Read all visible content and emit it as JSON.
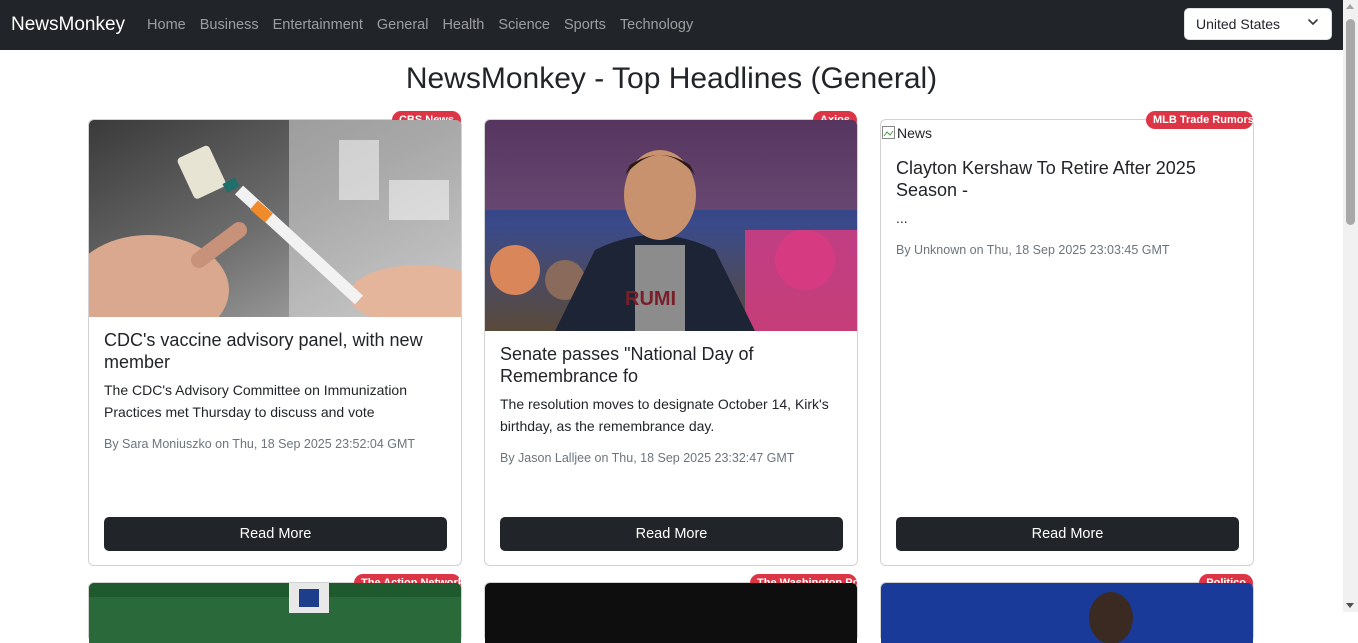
{
  "navbar": {
    "brand": "NewsMonkey",
    "links": [
      "Home",
      "Business",
      "Entertainment",
      "General",
      "Health",
      "Science",
      "Sports",
      "Technology"
    ],
    "country": "United States"
  },
  "page": {
    "title": "NewsMonkey - Top Headlines (General)"
  },
  "articles": [
    {
      "source": "CBS News",
      "title": "CDC's vaccine advisory panel, with new member",
      "description": "The CDC's Advisory Committee on Immunization Practices met Thursday to discuss and vote",
      "meta": "By Sara Moniuszko on Thu, 18 Sep 2025 23:52:04 GMT",
      "button": "Read More"
    },
    {
      "source": "Axios",
      "title": "Senate passes \"National Day of Remembrance fo",
      "description": "The resolution moves to designate October 14, Kirk's birthday, as the remembrance day.",
      "meta": "By Jason Lalljee on Thu, 18 Sep 2025 23:32:47 GMT",
      "button": "Read More"
    },
    {
      "source": "MLB Trade Rumors",
      "image_alt": "News",
      "title": "Clayton Kershaw To Retire After 2025 Season -",
      "description": "...",
      "meta": "By Unknown on Thu, 18 Sep 2025 23:03:45 GMT",
      "button": "Read More"
    },
    {
      "source": "The Action Network"
    },
    {
      "source": "The Washington Post"
    },
    {
      "source": "Politico"
    }
  ]
}
